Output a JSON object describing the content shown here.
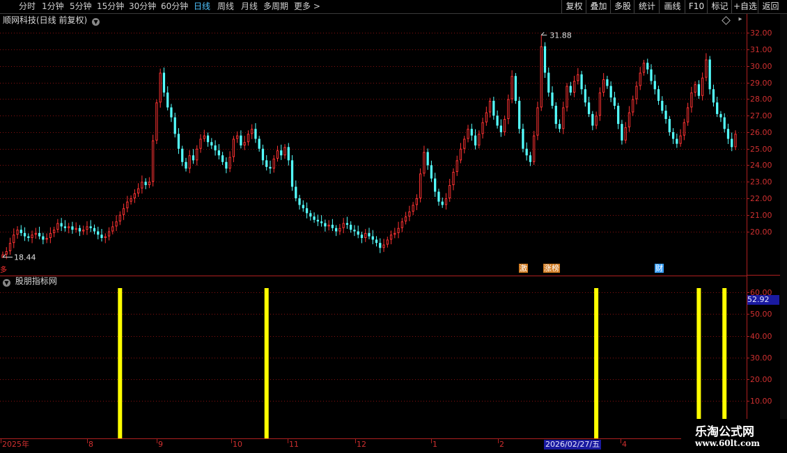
{
  "toolbar": {
    "periods": [
      {
        "label": "分时",
        "active": false
      },
      {
        "label": "1分钟",
        "active": false
      },
      {
        "label": "5分钟",
        "active": false
      },
      {
        "label": "15分钟",
        "active": false
      },
      {
        "label": "30分钟",
        "active": false
      },
      {
        "label": "60分钟",
        "active": false
      },
      {
        "label": "日线",
        "active": true
      },
      {
        "label": "周线",
        "active": false
      },
      {
        "label": "月线",
        "active": false
      },
      {
        "label": "多周期",
        "active": false
      },
      {
        "label": "更多 >",
        "active": false
      }
    ],
    "buttons": [
      "复权",
      "叠加",
      "多股",
      "统计",
      "画线",
      "F10",
      "标记",
      "+自选",
      "返回"
    ]
  },
  "main": {
    "title": "顺网科技(日线 前复权)",
    "low_label": "18.44",
    "high_label": "31.88",
    "price_ticks": [
      "32.00",
      "31.00",
      "30.00",
      "29.00",
      "28.00",
      "27.00",
      "26.00",
      "25.00",
      "24.00",
      "23.00",
      "22.00",
      "21.00",
      "20.00"
    ],
    "markers": [
      {
        "label": "激",
        "color": "#d07a20"
      },
      {
        "label": "涨榜",
        "color": "#d07a20"
      },
      {
        "label": "财",
        "color": "#3aa0ff"
      }
    ],
    "left_mark": "多"
  },
  "indicator": {
    "title": "股朋指标网",
    "ticks": [
      "60.00",
      "50.00",
      "40.00",
      "30.00",
      "20.00",
      "10.00"
    ],
    "current_value": "52.92"
  },
  "time_axis": {
    "labels": [
      "2025年",
      "8",
      "9",
      "10",
      "11",
      "12",
      "1",
      "2",
      "2026/02/27/五",
      "4"
    ]
  },
  "watermark": {
    "title": "乐淘公式网",
    "url": "www.60lt.com"
  },
  "colors": {
    "up": "#ff3232",
    "down": "#54ffff",
    "grid": "#8a1010",
    "signal": "#ffff00",
    "active": "#4fc3ff"
  },
  "chart_data": {
    "type": "candlestick",
    "title": "顺网科技(日线 前复权)",
    "ylim": [
      18.0,
      32.4
    ],
    "min": 18.44,
    "max": 31.88,
    "closes": [
      18.6,
      18.8,
      19.3,
      19.8,
      20.1,
      19.9,
      19.7,
      19.6,
      19.8,
      19.9,
      19.7,
      19.5,
      19.6,
      19.9,
      20.1,
      20.5,
      20.3,
      20.2,
      20.3,
      20.1,
      20.2,
      20.0,
      20.1,
      20.3,
      20.2,
      20.0,
      19.8,
      19.6,
      19.7,
      20.0,
      20.3,
      20.6,
      21.0,
      21.4,
      21.8,
      22.0,
      22.3,
      22.6,
      23.0,
      22.8,
      23.0,
      25.5,
      27.8,
      29.6,
      28.4,
      27.5,
      26.9,
      25.9,
      25.0,
      24.2,
      23.8,
      24.6,
      24.3,
      25.0,
      25.6,
      25.8,
      25.4,
      25.2,
      24.9,
      24.6,
      24.2,
      23.8,
      24.5,
      25.6,
      25.8,
      25.2,
      25.4,
      25.9,
      26.2,
      25.6,
      25.0,
      24.3,
      23.9,
      23.8,
      24.4,
      24.9,
      24.6,
      25.1,
      24.3,
      22.7,
      22.0,
      21.6,
      21.4,
      21.1,
      20.9,
      20.7,
      20.6,
      20.5,
      20.3,
      20.4,
      20.2,
      20.0,
      20.2,
      20.5,
      20.4,
      20.1,
      20.0,
      19.8,
      19.6,
      19.9,
      19.7,
      19.5,
      19.3,
      19.0,
      19.2,
      19.5,
      19.8,
      19.9,
      20.2,
      20.6,
      20.9,
      21.2,
      21.6,
      22.0,
      23.5,
      24.8,
      24.0,
      23.2,
      22.4,
      21.8,
      21.6,
      22.0,
      22.8,
      23.6,
      24.3,
      25.0,
      25.6,
      26.2,
      25.8,
      25.2,
      25.9,
      26.6,
      27.2,
      27.9,
      27.0,
      26.4,
      26.0,
      26.8,
      28.0,
      29.4,
      27.9,
      26.2,
      25.0,
      24.6,
      24.2,
      25.8,
      27.5,
      31.2,
      29.6,
      28.4,
      27.6,
      26.5,
      26.2,
      27.5,
      28.8,
      28.4,
      29.1,
      29.5,
      28.6,
      27.8,
      27.1,
      26.4,
      27.0,
      28.4,
      29.2,
      28.8,
      28.1,
      27.6,
      26.5,
      25.5,
      26.3,
      27.2,
      28.0,
      28.8,
      29.6,
      30.2,
      29.8,
      29.1,
      28.6,
      27.9,
      27.3,
      26.8,
      26.0,
      25.6,
      25.3,
      25.8,
      26.6,
      27.5,
      28.4,
      28.9,
      28.2,
      29.3,
      30.4,
      28.6,
      27.8,
      27.1,
      26.9,
      26.2,
      25.6,
      25.1,
      25.9
    ]
  },
  "indicator_data": {
    "type": "signal-bars",
    "signal_bar_indices": [
      32,
      72,
      162,
      190,
      197
    ]
  }
}
